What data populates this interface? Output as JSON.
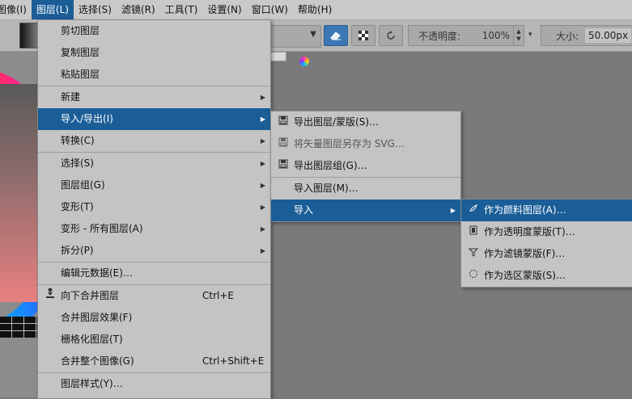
{
  "menubar": {
    "items": [
      {
        "label": "图像(I)"
      },
      {
        "label": "图层(L)",
        "active": true
      },
      {
        "label": "选择(S)"
      },
      {
        "label": "滤镜(R)"
      },
      {
        "label": "工具(T)"
      },
      {
        "label": "设置(N)"
      },
      {
        "label": "窗口(W)"
      },
      {
        "label": "帮助(H)"
      }
    ]
  },
  "toolbar": {
    "opacity_label": "不透明度:",
    "opacity_value": "100%",
    "size_label": "大小:",
    "size_value": "50.00px",
    "eraser_icon": "eraser-icon",
    "alpha_lock_icon": "checker-icon",
    "reload_icon": "reload-icon"
  },
  "layer_menu": {
    "items": [
      {
        "label": "剪切图层"
      },
      {
        "label": "复制图层"
      },
      {
        "label": "粘贴图层"
      },
      {
        "label": "新建"
      },
      {
        "label": "导入/导出(I)"
      },
      {
        "label": "转换(C)"
      },
      {
        "label": "选择(S)"
      },
      {
        "label": "图层组(G)"
      },
      {
        "label": "变形(T)"
      },
      {
        "label": "变形 - 所有图层(A)"
      },
      {
        "label": "拆分(P)"
      },
      {
        "label": "编辑元数据(E)…"
      },
      {
        "label": "向下合并图层",
        "shortcut": "Ctrl+E"
      },
      {
        "label": "合并图层效果(F)"
      },
      {
        "label": "栅格化图层(T)"
      },
      {
        "label": "合并整个图像(G)",
        "shortcut": "Ctrl+Shift+E"
      },
      {
        "label": "图层样式(Y)…"
      }
    ]
  },
  "import_export_menu": {
    "items": [
      {
        "label": "导出图层/蒙版(S)…"
      },
      {
        "label": "将矢量图层另存为 SVG…"
      },
      {
        "label": "导出图层组(G)…"
      },
      {
        "label": "导入图层(M)…"
      },
      {
        "label": "导入"
      }
    ]
  },
  "import_menu": {
    "items": [
      {
        "label": "作为颜料图层(A)…"
      },
      {
        "label": "作为透明度蒙版(T)…"
      },
      {
        "label": "作为滤镜蒙版(F)…"
      },
      {
        "label": "作为选区蒙版(S)…"
      }
    ]
  },
  "colors": {
    "highlight": "#1a5d97",
    "menu_bg": "#c4c4c4"
  }
}
